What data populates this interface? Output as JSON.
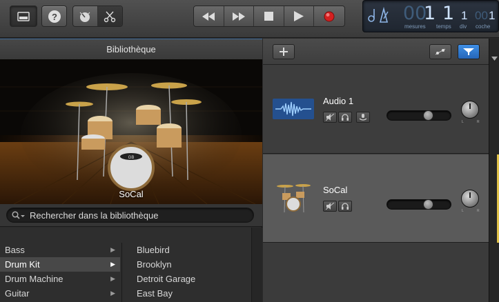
{
  "toolbar": {
    "library_icon": "library-icon",
    "help_icon": "question-icon",
    "smart_controls_icon": "knob-icon",
    "editors_icon": "scissors-icon",
    "transport": {
      "rewind_icon": "rewind-icon",
      "forward_icon": "fast-forward-icon",
      "stop_icon": "stop-icon",
      "play_icon": "play-icon",
      "record_icon": "record-icon",
      "record_color": "#d42020"
    },
    "lcd": {
      "metronome_icon": "metronome-icon",
      "bars_dim": "00",
      "bars": "1",
      "beat": "1",
      "div": "1",
      "tick_dim": "00",
      "tick": "1",
      "label_bars": "mesures",
      "label_beat": "temps",
      "label_div": "div",
      "label_tick": "coche"
    }
  },
  "library": {
    "title": "Bibliothèque",
    "preview_name": "SoCal",
    "search_placeholder": "Rechercher dans la bibliothèque",
    "categories": [
      {
        "label": "Bass",
        "selected": false
      },
      {
        "label": "Drum Kit",
        "selected": true
      },
      {
        "label": "Drum Machine",
        "selected": false
      },
      {
        "label": "Guitar",
        "selected": false
      }
    ],
    "kits": [
      "Bluebird",
      "Brooklyn",
      "Detroit Garage",
      "East Bay"
    ]
  },
  "tracks": {
    "add_icon": "plus-icon",
    "automation_icon": "automation-icon",
    "filter_icon": "filter-icon",
    "accent_color": "#2f7fd8",
    "items": [
      {
        "name": "Audio 1",
        "icon": "waveform-icon",
        "volume": 0.67,
        "pan_left": "L",
        "pan_right": "R"
      },
      {
        "name": "SoCal",
        "icon": "drum-kit-icon",
        "volume": 0.67,
        "pan_left": "L",
        "pan_right": "R"
      }
    ]
  }
}
